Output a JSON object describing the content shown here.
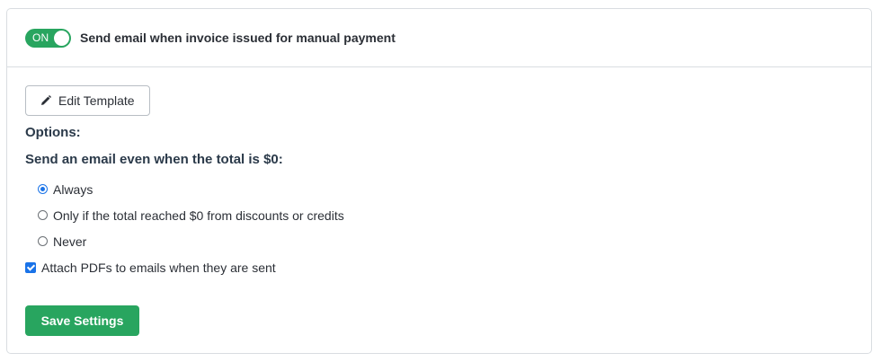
{
  "header": {
    "toggle_label": "ON",
    "toggle_state": "on",
    "title": "Send email when invoice issued for manual payment"
  },
  "toolbar": {
    "edit_template_label": "Edit Template",
    "edit_template_icon": "pencil-icon"
  },
  "options": {
    "title": "Options:",
    "question": "Send an email even when the total is $0:",
    "radios": [
      {
        "label": "Always",
        "checked": true
      },
      {
        "label": "Only if the total reached $0 from discounts or credits",
        "checked": false
      },
      {
        "label": "Never",
        "checked": false
      }
    ],
    "attach_pdfs": {
      "label": "Attach PDFs to emails when they are sent",
      "checked": true
    }
  },
  "actions": {
    "save_label": "Save Settings"
  },
  "colors": {
    "accent_green": "#28a55f",
    "control_blue": "#1a73e8",
    "border": "#d9dde1"
  }
}
